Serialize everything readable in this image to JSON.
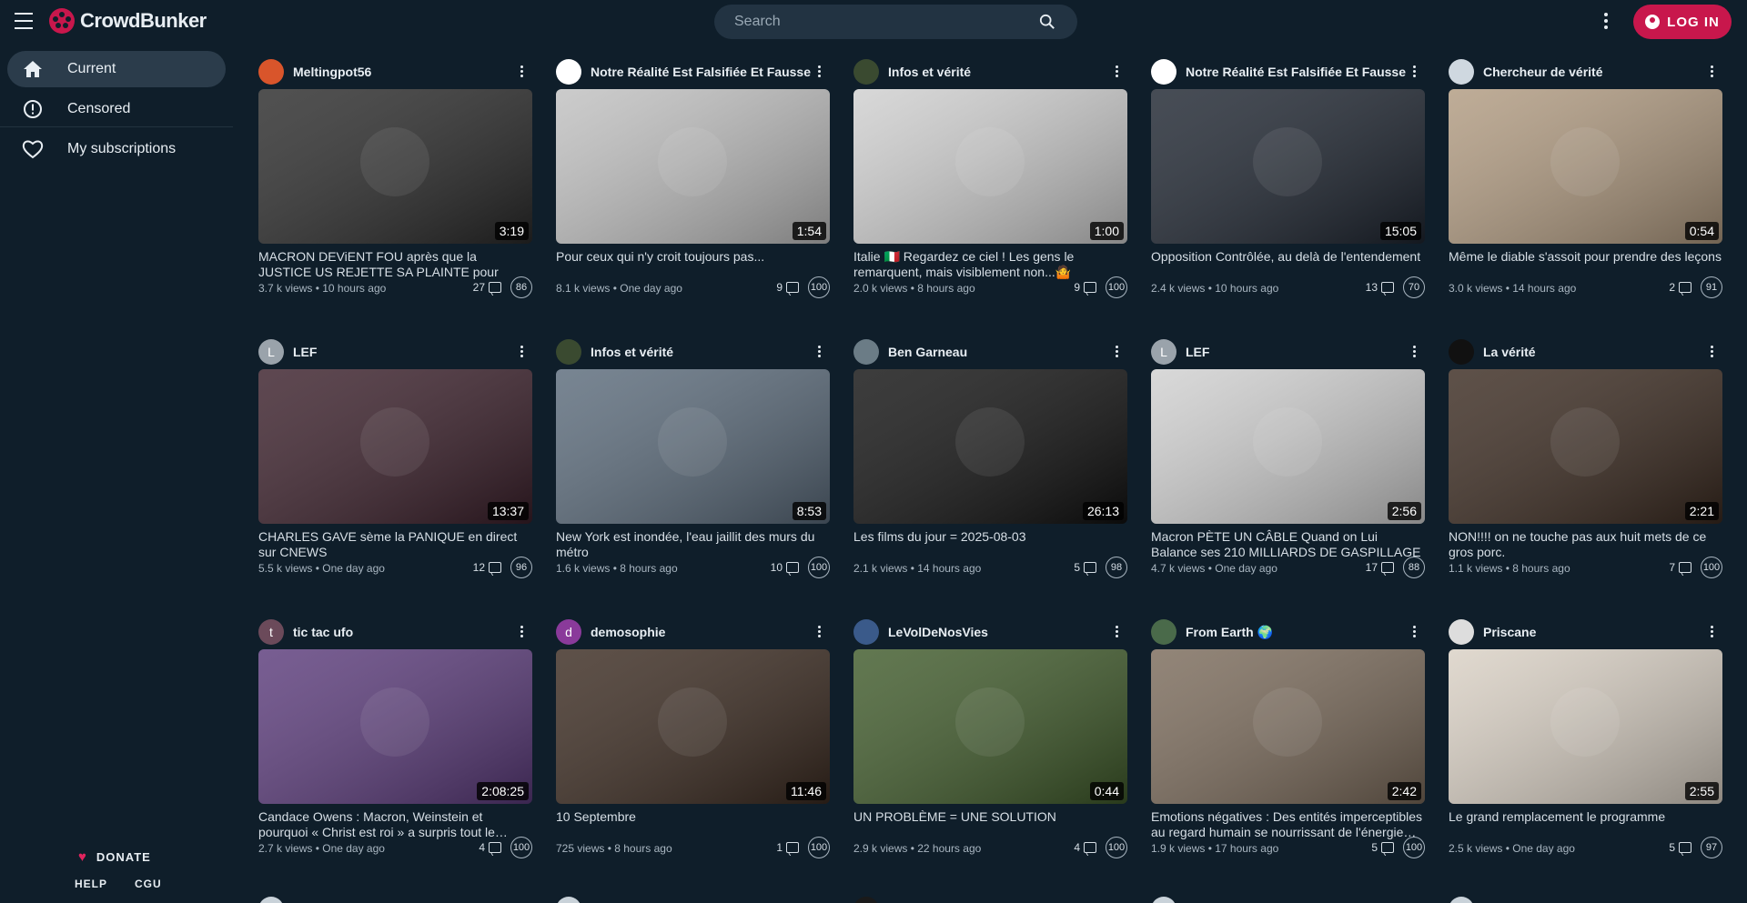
{
  "header": {
    "logo_text": "CrowdBunker",
    "search_placeholder": "Search",
    "login_label": "LOG IN",
    "brand_color": "#c8174c"
  },
  "sidebar": {
    "items": [
      {
        "label": "Current",
        "icon": "home-icon",
        "active": true
      },
      {
        "label": "Censored",
        "icon": "alert-circle-icon",
        "active": false
      },
      {
        "label": "My subscriptions",
        "icon": "heart-outline-icon",
        "active": false
      }
    ],
    "donate_label": "DONATE",
    "help_label": "HELP",
    "cgu_label": "CGU"
  },
  "videos": [
    {
      "channel": "Meltingpot56",
      "duration": "3:19",
      "title": "MACRON DEViENT FOU après que la JUSTICE US REJETTE SA PLAINTE pour DIFFAMATION…",
      "views": "3.7 k views",
      "age": "10 hours ago",
      "comments": "27",
      "score": "86"
    },
    {
      "channel": "Notre Réalité Est Falsifiée Et Fausse",
      "duration": "1:54",
      "title": "Pour ceux qui n'y croit toujours pas...",
      "views": "8.1 k views",
      "age": "One day ago",
      "comments": "9",
      "score": "100"
    },
    {
      "channel": "Infos et vérité",
      "duration": "1:00",
      "title": "Italie 🇮🇹 Regardez ce ciel ! Les gens le remarquent, mais visiblement non...🤷",
      "views": "2.0 k views",
      "age": "8 hours ago",
      "comments": "9",
      "score": "100"
    },
    {
      "channel": "Notre Réalité Est Falsifiée Et Fausse",
      "duration": "15:05",
      "title": "Opposition Contrôlée, au delà de l'entendement",
      "views": "2.4 k views",
      "age": "10 hours ago",
      "comments": "13",
      "score": "70"
    },
    {
      "channel": "Chercheur de vérité",
      "duration": "0:54",
      "title": "Même le diable s'assoit pour prendre des leçons",
      "views": "3.0 k views",
      "age": "14 hours ago",
      "comments": "2",
      "score": "91"
    },
    {
      "channel": "LEF",
      "duration": "13:37",
      "title": "CHARLES GAVE sème la PANIQUE en direct sur CNEWS",
      "views": "5.5 k views",
      "age": "One day ago",
      "comments": "12",
      "score": "96"
    },
    {
      "channel": "Infos et vérité",
      "duration": "8:53",
      "title": "New York est inondée, l'eau jaillit des murs du métro",
      "views": "1.6 k views",
      "age": "8 hours ago",
      "comments": "10",
      "score": "100"
    },
    {
      "channel": "Ben Garneau",
      "duration": "26:13",
      "title": "Les films du jour = 2025-08-03",
      "views": "2.1 k views",
      "age": "14 hours ago",
      "comments": "5",
      "score": "98"
    },
    {
      "channel": "LEF",
      "duration": "2:56",
      "title": "Macron PÈTE UN CÂBLE Quand on Lui Balance ses 210 MILLIARDS DE GASPILLAGE !",
      "views": "4.7 k views",
      "age": "One day ago",
      "comments": "17",
      "score": "88"
    },
    {
      "channel": "La vérité",
      "duration": "2:21",
      "title": "NON!!!! on ne touche pas aux huit mets de ce gros porc.",
      "views": "1.1 k views",
      "age": "8 hours ago",
      "comments": "7",
      "score": "100"
    },
    {
      "channel": "tic tac ufo",
      "duration": "2:08:25",
      "title": "Candace Owens : Macron, Weinstein et pourquoi « Christ est roi » a surpris tout le…",
      "views": "2.7 k views",
      "age": "One day ago",
      "comments": "4",
      "score": "100"
    },
    {
      "channel": "demosophie",
      "duration": "11:46",
      "title": "10 Septembre",
      "views": "725 views",
      "age": "8 hours ago",
      "comments": "1",
      "score": "100"
    },
    {
      "channel": "LeVolDeNosVies",
      "duration": "0:44",
      "title": "UN PROBLÈME = UNE SOLUTION",
      "views": "2.9 k views",
      "age": "22 hours ago",
      "comments": "4",
      "score": "100"
    },
    {
      "channel": "From Earth 🌍",
      "duration": "2:42",
      "title": "Emotions négatives : Des entités imperceptibles au regard humain se nourrissant de l'énergie…",
      "views": "1.9 k views",
      "age": "17 hours ago",
      "comments": "5",
      "score": "100"
    },
    {
      "channel": "Priscane",
      "duration": "2:55",
      "title": "Le grand remplacement le programme",
      "views": "2.5 k views",
      "age": "One day ago",
      "comments": "5",
      "score": "97"
    }
  ],
  "avatars": [
    {
      "letter": "",
      "color": "#d9552b"
    },
    {
      "letter": "",
      "color": "#ffffff"
    },
    {
      "letter": "",
      "color": "#3a4a30"
    },
    {
      "letter": "",
      "color": "#ffffff"
    },
    {
      "letter": "",
      "color": "#cfd8e0"
    },
    {
      "letter": "L",
      "color": "#9aa3ab"
    },
    {
      "letter": "",
      "color": "#3a4a30"
    },
    {
      "letter": "",
      "color": "#6b7c86"
    },
    {
      "letter": "L",
      "color": "#9aa3ab"
    },
    {
      "letter": "",
      "color": "#111111"
    },
    {
      "letter": "t",
      "color": "#6b4a5a"
    },
    {
      "letter": "d",
      "color": "#8a3a9a"
    },
    {
      "letter": "",
      "color": "#3a5a8a"
    },
    {
      "letter": "",
      "color": "#4a6a4a"
    },
    {
      "letter": "",
      "color": "#dddddd"
    }
  ]
}
